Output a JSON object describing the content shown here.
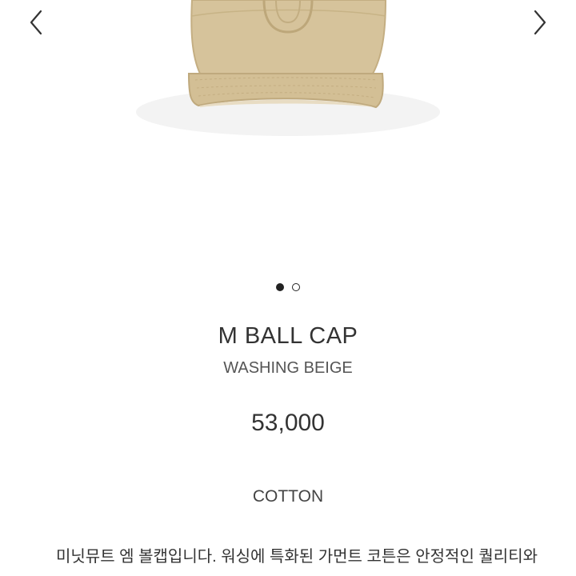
{
  "carousel": {
    "prev_icon": "chevron-left-icon",
    "next_icon": "chevron-right-icon",
    "slide_count": 2,
    "active_slide": 1,
    "image_color": "#d4c097"
  },
  "product": {
    "title": "M BALL CAP",
    "color": "WASHING BEIGE",
    "price": "53,000",
    "material": "COTTON",
    "description_line1": "미닛뮤트 엠 볼캡입니다. 워싱에 특화된 가먼트 코튼은 안정적인 퀄리티와"
  }
}
